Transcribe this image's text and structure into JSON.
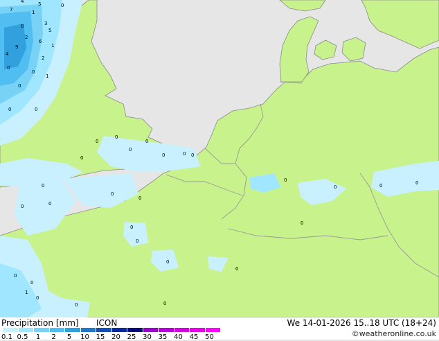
{
  "map": {
    "colors": {
      "sea": "#e6e6e6",
      "land": "#c8f28c",
      "border": "#9a9a9a",
      "coast": "#8a8a8a"
    },
    "precip_value_labels": [
      "4",
      "5",
      "0",
      "7",
      "1",
      "3",
      "8",
      "5",
      "2",
      "6",
      "9",
      "4",
      "1",
      "2",
      "0",
      "0",
      "1",
      "0",
      "0",
      "0",
      "0",
      "0",
      "0",
      "0",
      "0",
      "0",
      "0",
      "0",
      "0",
      "0",
      "0",
      "0",
      "0",
      "0",
      "0",
      "0",
      "0",
      "0",
      "0",
      "0",
      "0",
      "0",
      "0",
      "0",
      "1",
      "0",
      "0",
      "0"
    ]
  },
  "legend": {
    "title": "Precipitation [mm]",
    "model": "ICON",
    "datetime": "We 14-01-2026 15..18 UTC (18+24)",
    "credit": "©weatheronline.co.uk",
    "scale_labels": [
      "0.1",
      "0.5",
      "1",
      "2",
      "5",
      "10",
      "15",
      "20",
      "25",
      "30",
      "35",
      "40",
      "45",
      "50"
    ],
    "scale_colors": [
      "#c8f0ff",
      "#a0e6ff",
      "#78d2f5",
      "#50bef0",
      "#32a0dc",
      "#1e78c8",
      "#1450b4",
      "#0a2896",
      "#000a78",
      "#9600c8",
      "#b400d2",
      "#d200dc",
      "#e600e6",
      "#ff00ff"
    ]
  }
}
